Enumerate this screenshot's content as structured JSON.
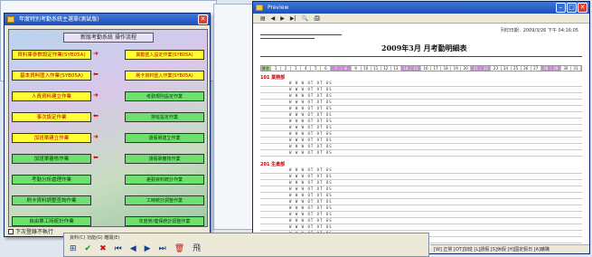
{
  "menu_window": {
    "title": "年度特別考勤系統主選單(測試版)",
    "panel_title": "新版考勤系統 操作流程",
    "buttons_left": [
      "資料庫參數設定作業(SYB05A)",
      "基本資料匯入作業(SYB05A)",
      "人員資料建立作業",
      "事次設定作業",
      "加班單建立作業",
      "加班單審核作業",
      "考勤分析處理作業",
      "刷卡資料調整查詢作業",
      "自由單工時統計作業"
    ],
    "buttons_right": [
      "異動匯入設定作業(SYB05A)",
      "刷卡資料匯入作業(SYB05A)",
      "考勤規則設定作業",
      "排班設定作業",
      "請假單建立作業",
      "請假單審核作業",
      "差勤資料統計作業",
      "工時統計調整作業",
      "年度勞/健保統計調整作業"
    ],
    "checkbox_label": "下次登錄不執行"
  },
  "preview_window": {
    "title": "Preview",
    "toolbar": [
      "▤",
      "◀",
      "▶",
      "▶|",
      "🔍",
      "🖨"
    ],
    "print_date": "列印日期：2009/3/26 下午 04:16:05",
    "report_title": "2009年3月 月考勤明細表",
    "day_headers": [
      "姓名",
      "1",
      "2",
      "3",
      "4",
      "5",
      "6",
      "7",
      "8",
      "9",
      "10",
      "11",
      "12",
      "13",
      "14",
      "15",
      "16",
      "17",
      "18",
      "19",
      "20",
      "21",
      "22",
      "23",
      "24",
      "25",
      "26",
      "27",
      "28",
      "29",
      "30",
      "31"
    ],
    "section_a": "101 業務部",
    "section_b": "201 生產部",
    "row_code": "W W W OT OT OS",
    "status_text": "[W] 正常 [OT]加班 [L]請假 [S]休假 [H]國定假日 [A]曠職"
  },
  "nav_window": {
    "label": "資料(C)  功能(G)  離開(E)",
    "buttons": [
      "⊞",
      "✔",
      "✖",
      "⏮",
      "◀",
      "▶",
      "⏭",
      "🗑",
      "飛"
    ]
  }
}
